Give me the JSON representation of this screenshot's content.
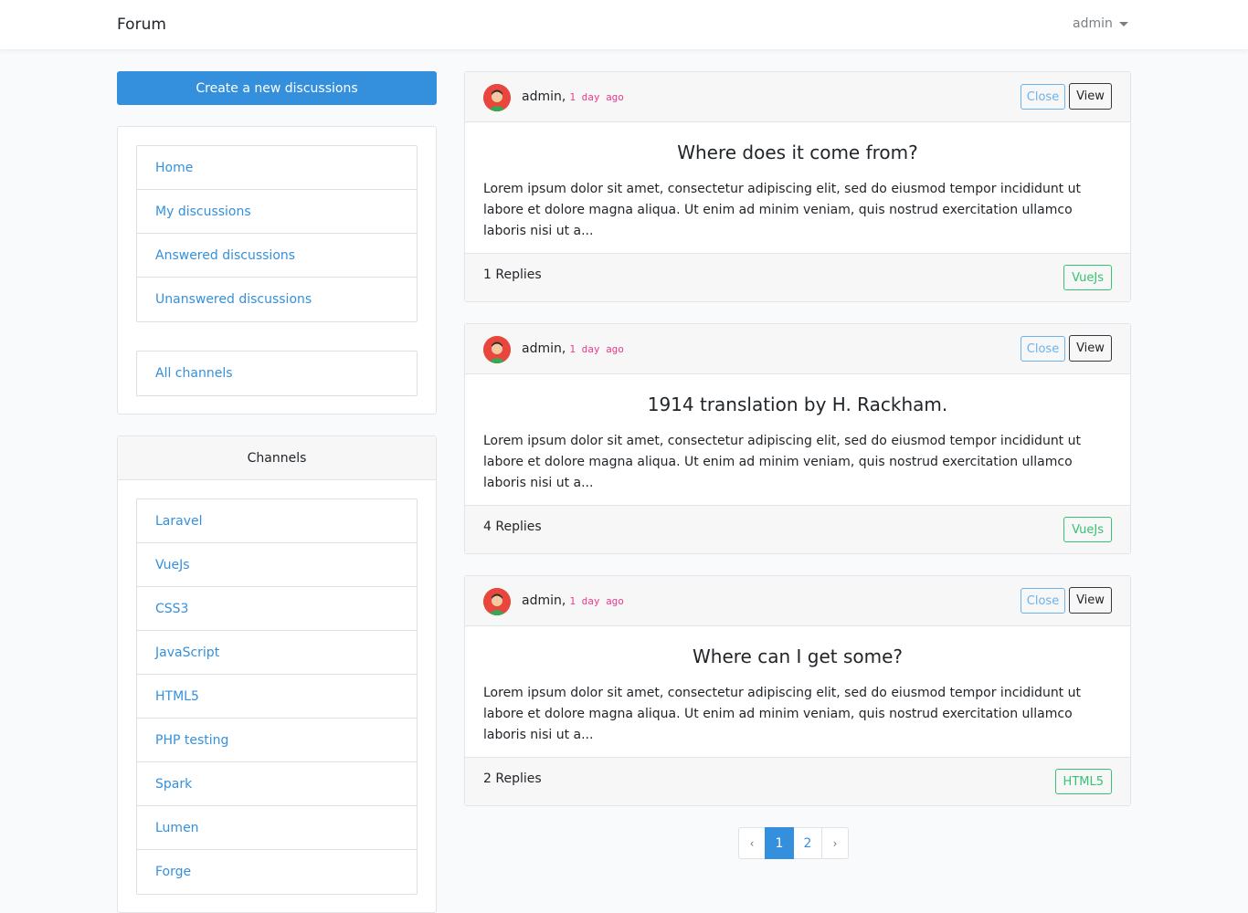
{
  "navbar": {
    "brand": "Forum",
    "user": "admin"
  },
  "sidebar": {
    "create_button": "Create a new discussions",
    "nav_items": [
      {
        "label": "Home"
      },
      {
        "label": "My discussions"
      },
      {
        "label": "Answered discussions"
      },
      {
        "label": "Unanswered discussions"
      }
    ],
    "all_channels": "All channels",
    "channels_header": "Channels",
    "channels": [
      {
        "label": "Laravel"
      },
      {
        "label": "VueJs"
      },
      {
        "label": "CSS3"
      },
      {
        "label": "JavaScript"
      },
      {
        "label": "HTML5"
      },
      {
        "label": "PHP testing"
      },
      {
        "label": "Spark"
      },
      {
        "label": "Lumen"
      },
      {
        "label": "Forge"
      }
    ]
  },
  "discussions": [
    {
      "author": "admin,",
      "time": "1 day ago",
      "close_label": "Close",
      "view_label": "View",
      "title": "Where does it come from?",
      "excerpt": "Lorem ipsum dolor sit amet, consectetur adipiscing elit, sed do eiusmod tempor incididunt ut labore et dolore magna aliqua. Ut enim ad minim veniam, quis nostrud exercitation ullamco laboris nisi ut a...",
      "replies": "1 Replies",
      "channel": "VueJs"
    },
    {
      "author": "admin,",
      "time": "1 day ago",
      "close_label": "Close",
      "view_label": "View",
      "title": "1914 translation by H. Rackham.",
      "excerpt": "Lorem ipsum dolor sit amet, consectetur adipiscing elit, sed do eiusmod tempor incididunt ut labore et dolore magna aliqua. Ut enim ad minim veniam, quis nostrud exercitation ullamco laboris nisi ut a...",
      "replies": "4 Replies",
      "channel": "VueJs"
    },
    {
      "author": "admin,",
      "time": "1 day ago",
      "close_label": "Close",
      "view_label": "View",
      "title": "Where can I get some?",
      "excerpt": "Lorem ipsum dolor sit amet, consectetur adipiscing elit, sed do eiusmod tempor incididunt ut labore et dolore magna aliqua. Ut enim ad minim veniam, quis nostrud exercitation ullamco laboris nisi ut a...",
      "replies": "2 Replies",
      "channel": "HTML5"
    }
  ],
  "pagination": {
    "prev": "‹",
    "pages": [
      "1",
      "2"
    ],
    "active_page": "1",
    "next": "›"
  },
  "colors": {
    "primary": "#3490dc",
    "info": "#6cb2eb",
    "success": "#38c172",
    "time": "#e83e8c"
  }
}
